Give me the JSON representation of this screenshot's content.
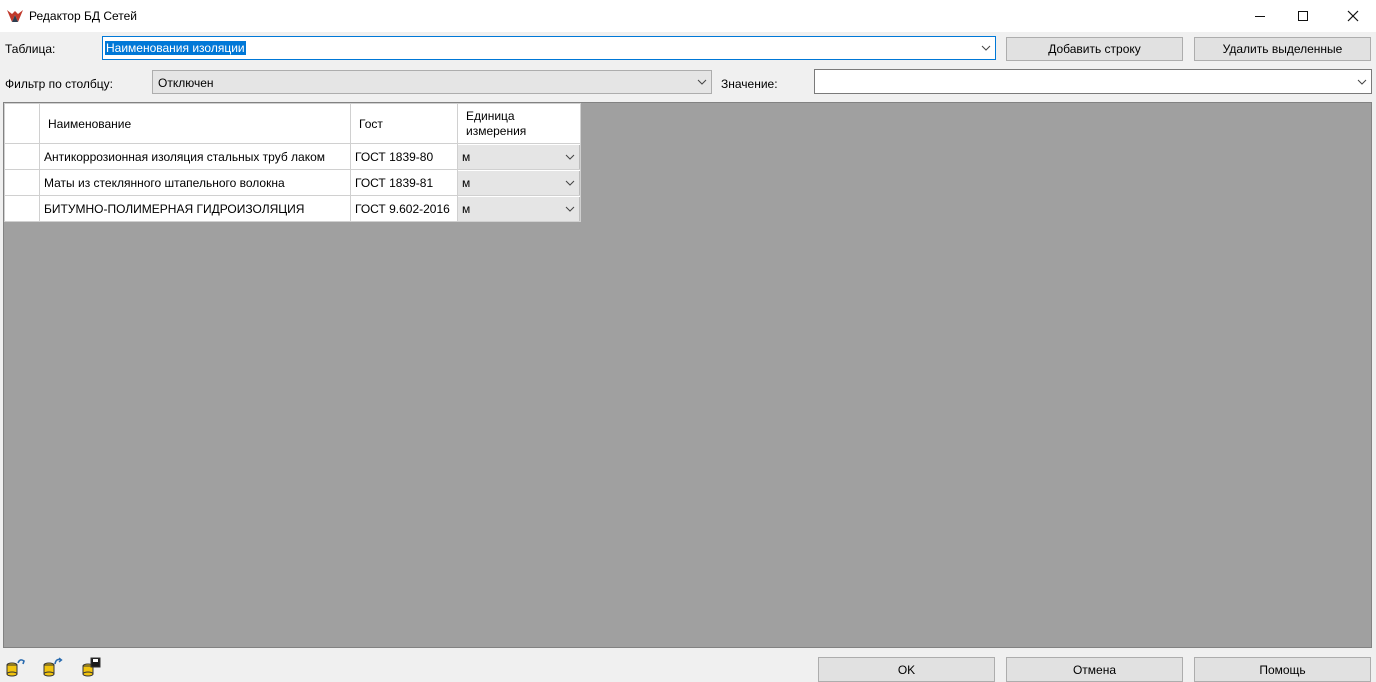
{
  "window": {
    "title": "Редактор БД Сетей",
    "minimize": "—",
    "maximize": "☐",
    "close": "✕"
  },
  "toolbar": {
    "table_label": "Таблица:",
    "table_value": "Наименования изоляции",
    "add_row": "Добавить строку",
    "delete_selected": "Удалить выделенные",
    "filter_label": "Фильтр по столбцу:",
    "filter_value": "Отключен",
    "value_label": "Значение:",
    "value_value": ""
  },
  "grid": {
    "columns": [
      "Наименование",
      "Гост",
      "Единица\nизмерения"
    ],
    "rows": [
      {
        "name": "Антикоррозионная изоляция стальных труб лаком",
        "gost": "ГОСТ 1839-80",
        "unit": "м"
      },
      {
        "name": "Маты из стеклянного штапельного волокна",
        "gost": "ГОСТ 1839-81",
        "unit": "м"
      },
      {
        "name": "БИТУМНО-ПОЛИМЕРНАЯ ГИДРОИЗОЛЯЦИЯ",
        "gost": "ГОСТ 9.602-2016",
        "unit": "м"
      }
    ]
  },
  "footer": {
    "ok": "OK",
    "cancel": "Отмена",
    "help": "Помощь",
    "icons": [
      "db-load-icon",
      "db-refresh-icon",
      "db-export-icon"
    ]
  },
  "colors": {
    "selection": "#0078d7",
    "grid_background": "#a0a0a0",
    "icon_red": "#c0392b"
  }
}
